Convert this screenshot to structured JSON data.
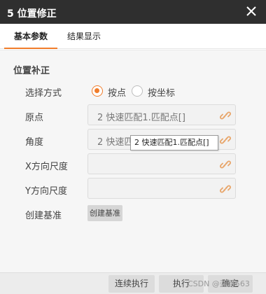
{
  "window": {
    "title": "5 位置修正"
  },
  "tabs": [
    {
      "label": "基本参数"
    },
    {
      "label": "结果显示"
    }
  ],
  "section": {
    "title": "位置补正"
  },
  "mode": {
    "label": "选择方式",
    "options": [
      {
        "label": "按点",
        "selected": true
      },
      {
        "label": "按坐标",
        "selected": false
      }
    ]
  },
  "fields": [
    {
      "label": "原点",
      "value": "2 快速匹配1.匹配点[]"
    },
    {
      "label": "角度",
      "value": "2 快速匹配1.匹配点[]"
    },
    {
      "label": "X方向尺度",
      "value": ""
    },
    {
      "label": "Y方向尺度",
      "value": ""
    }
  ],
  "tooltip": {
    "text": "2 快速匹配1.匹配点[]"
  },
  "create_base": {
    "label": "创建基准",
    "button": "创建基准"
  },
  "footer": {
    "buttons": [
      "连续执行",
      "执行",
      "确定"
    ],
    "watermark": "CSDN @蓝哥563"
  },
  "colors": {
    "accent": "#f07c2a",
    "titlebar": "#2f2f2f"
  }
}
